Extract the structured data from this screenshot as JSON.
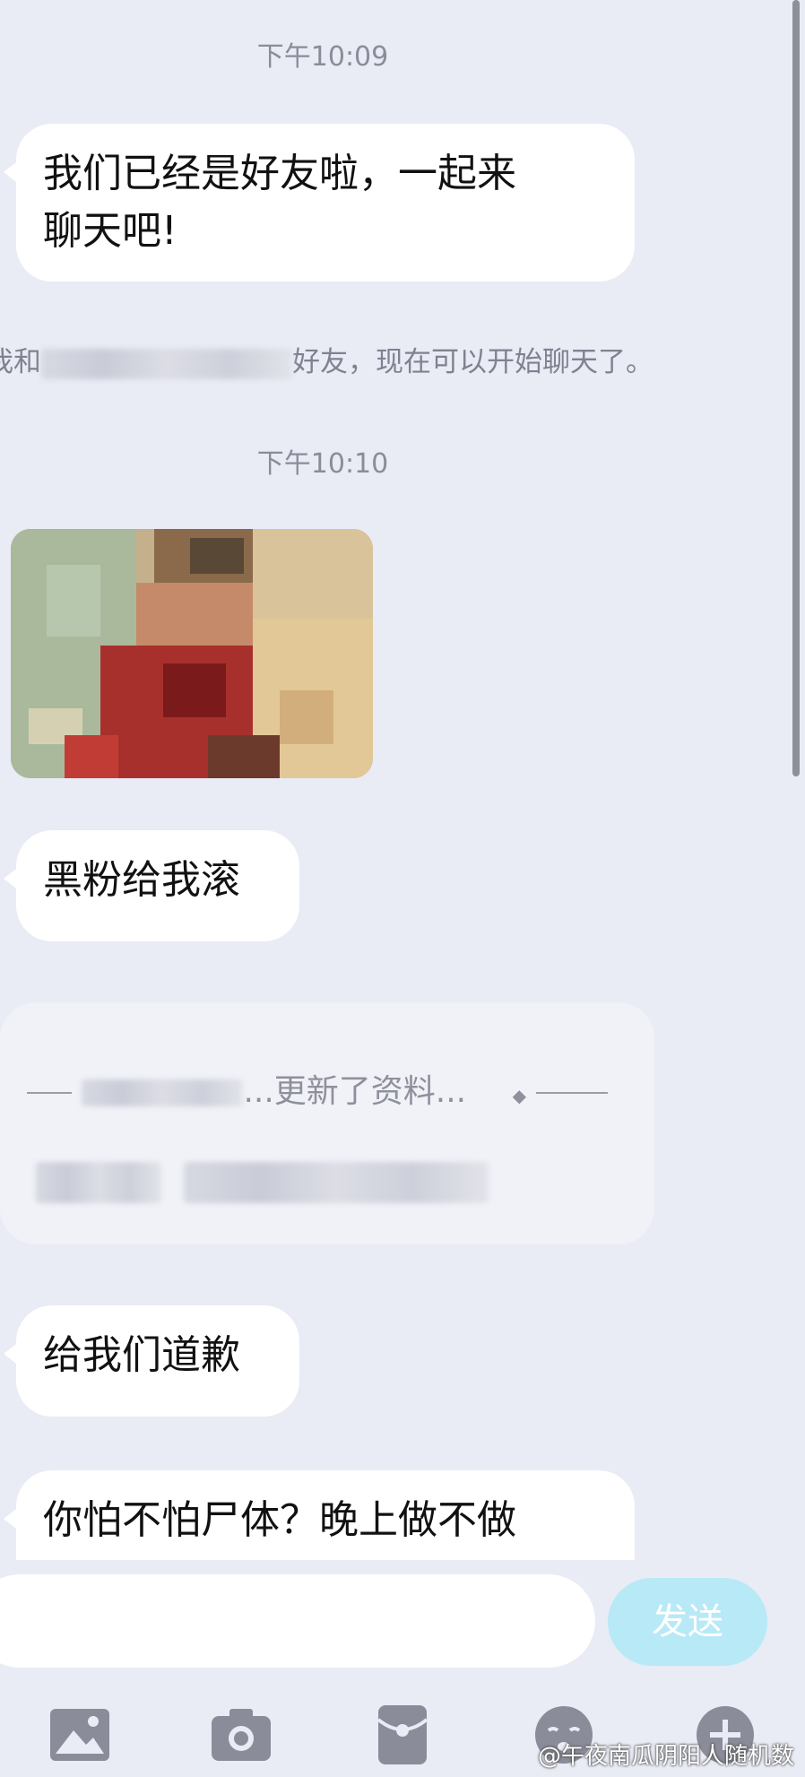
{
  "messages": {
    "time1": "下午10:09",
    "msg1_line1": "我们已经是好友啦，一起来",
    "msg1_line2": "聊天吧!",
    "system_prefix": "我和",
    "system_suffix": "好友，现在可以开始聊天了。",
    "time2": "下午10:10",
    "msg2": "黑粉给我滚",
    "card_title": "...更新了资料...",
    "msg3": "给我们道歉",
    "msg4": "你怕不怕尸体？晚上做不做"
  },
  "input": {
    "placeholder": "",
    "send_label": "发送"
  },
  "toolbar": {
    "icons": [
      "image-icon",
      "camera-icon",
      "red-packet-icon",
      "emoji-icon",
      "plus-icon"
    ]
  },
  "watermark": "@午夜南瓜阴阳人随机数",
  "colors": {
    "background": "#e9ebf5",
    "bubble": "#ffffff",
    "send_button": "#b8e9f7",
    "icon": "#8a8c99"
  }
}
